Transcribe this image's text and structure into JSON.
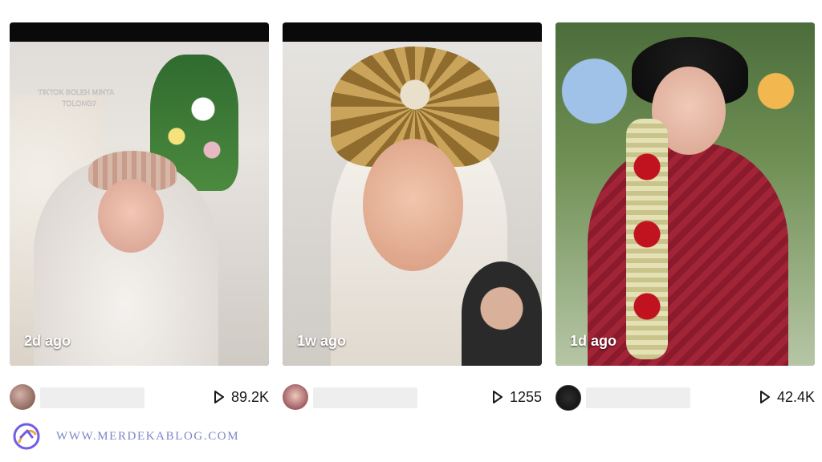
{
  "cards": [
    {
      "age": "2d ago",
      "plays": "89.2K",
      "image_text": "TIKTOK BOLEH MINTA TOLONG?"
    },
    {
      "age": "1w ago",
      "plays": "1255"
    },
    {
      "age": "1d ago",
      "plays": "42.4K"
    }
  ],
  "brand": {
    "text": "WWW.MERDEKABLOG.COM",
    "colors": {
      "text": "#7b86c8",
      "logo_primary": "#6f5de8",
      "logo_secondary": "#f2a545"
    }
  },
  "icons": {
    "play": "play-icon",
    "logo": "brand-logo-icon"
  }
}
